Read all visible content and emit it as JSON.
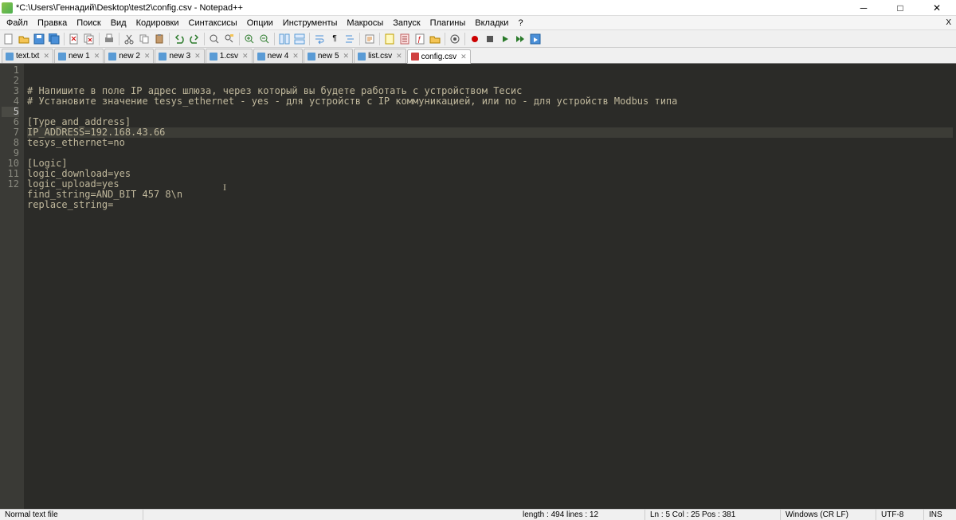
{
  "window": {
    "title": "*C:\\Users\\Геннадий\\Desktop\\test2\\config.csv - Notepad++"
  },
  "menu": {
    "items": [
      "Файл",
      "Правка",
      "Поиск",
      "Вид",
      "Кодировки",
      "Синтаксисы",
      "Опции",
      "Инструменты",
      "Макросы",
      "Запуск",
      "Плагины",
      "Вкладки",
      "?"
    ]
  },
  "tabs": [
    {
      "label": "text.txt",
      "active": false,
      "unsaved": false
    },
    {
      "label": "new 1",
      "active": false,
      "unsaved": false
    },
    {
      "label": "new 2",
      "active": false,
      "unsaved": false
    },
    {
      "label": "new 3",
      "active": false,
      "unsaved": false
    },
    {
      "label": "1.csv",
      "active": false,
      "unsaved": false
    },
    {
      "label": "new 4",
      "active": false,
      "unsaved": false
    },
    {
      "label": "new 5",
      "active": false,
      "unsaved": false
    },
    {
      "label": "list.csv",
      "active": false,
      "unsaved": false
    },
    {
      "label": "config.csv",
      "active": true,
      "unsaved": true
    }
  ],
  "editor": {
    "active_line": 5,
    "lines": [
      "# Напишите в поле IP адрес шлюза, через который вы будете работать с устройством Тесис",
      "# Установите значение tesys_ethernet - yes - для устройств с IP коммуникацией, или no - для устройств Modbus типа",
      "",
      "[Type_and_address]",
      "IP_ADDRESS=192.168.43.66",
      "tesys_ethernet=no",
      "",
      "[Logic]",
      "logic_download=yes",
      "logic_upload=yes",
      "find_string=AND_BIT 457 8\\n",
      "replace_string="
    ]
  },
  "status": {
    "filetype": "Normal text file",
    "length_lines": "length : 494    lines : 12",
    "position": "Ln : 5    Col : 25    Pos : 381",
    "eol": "Windows (CR LF)",
    "encoding": "UTF-8",
    "mode": "INS"
  }
}
